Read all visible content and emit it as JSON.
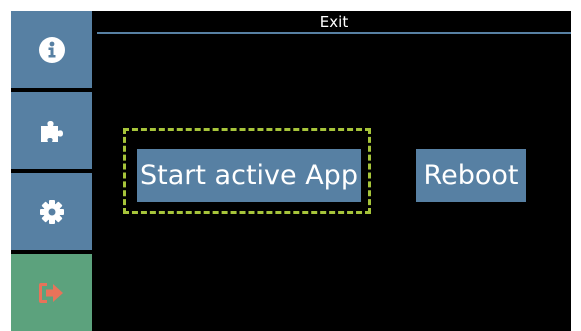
{
  "header": {
    "title": "Exit"
  },
  "sidebar": {
    "items": [
      {
        "icon": "info-icon",
        "selected": false
      },
      {
        "icon": "puzzle-icon",
        "selected": false
      },
      {
        "icon": "gear-icon",
        "selected": false
      },
      {
        "icon": "exit-icon",
        "selected": true
      }
    ]
  },
  "main": {
    "start_app_label": "Start active App",
    "reboot_label": "Reboot",
    "focused_button": "Start active App"
  },
  "colors": {
    "button_blue": "#5780a3",
    "selected_green": "#5ca27d",
    "focus_dash": "#a6c43a",
    "exit_icon_red": "#e8735a",
    "background": "#000000"
  }
}
